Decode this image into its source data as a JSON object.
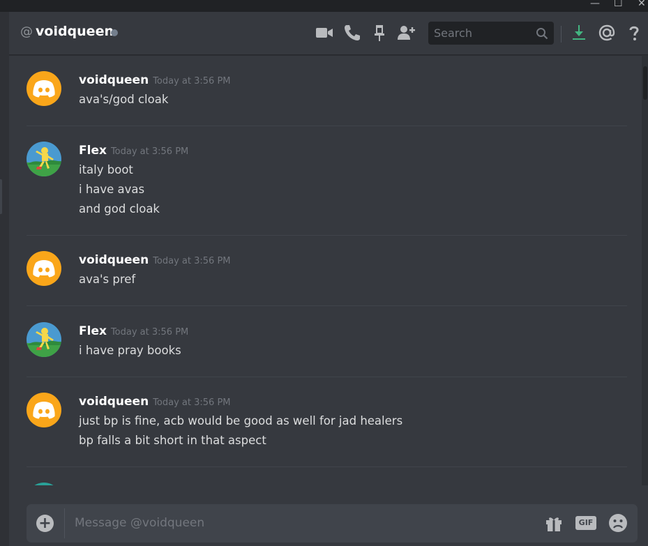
{
  "window": {
    "minimize_glyph": "—",
    "maximize_glyph": "☐",
    "close_glyph": "✕"
  },
  "header": {
    "at_symbol": "@",
    "channel_name": "voidqueen",
    "status": "offline",
    "icons": [
      "video-call-icon",
      "phone-call-icon",
      "pin-icon",
      "add-friend-icon",
      "download-icon",
      "mention-icon",
      "help-icon"
    ],
    "search": {
      "placeholder": "Search"
    }
  },
  "colors": {
    "background": "#36393f",
    "discord_avatar": "#faa61a",
    "download_accent": "#43b581"
  },
  "messages": [
    {
      "author": "voidqueen",
      "timestamp": "Today at 3:56 PM",
      "avatar": "discord-default-avatar",
      "lines": [
        "ava's/god cloak"
      ]
    },
    {
      "author": "Flex",
      "timestamp": "Today at 3:56 PM",
      "avatar": "user-avatar",
      "lines": [
        "italy boot",
        "i have avas",
        "and god cloak"
      ]
    },
    {
      "author": "voidqueen",
      "timestamp": "Today at 3:56 PM",
      "avatar": "discord-default-avatar",
      "lines": [
        "ava's pref"
      ]
    },
    {
      "author": "Flex",
      "timestamp": "Today at 3:56 PM",
      "avatar": "user-avatar",
      "lines": [
        "i have pray books"
      ]
    },
    {
      "author": "voidqueen",
      "timestamp": "Today at 3:56 PM",
      "avatar": "discord-default-avatar",
      "lines": [
        "just bp is fine, acb would be good as well for jad healers",
        "bp falls a bit short in that aspect"
      ]
    }
  ],
  "composer": {
    "placeholder": "Message @voidqueen",
    "gif_label": "GIF",
    "icons": [
      "add-attachment-icon",
      "gift-icon",
      "gif-icon",
      "emoji-icon"
    ]
  }
}
